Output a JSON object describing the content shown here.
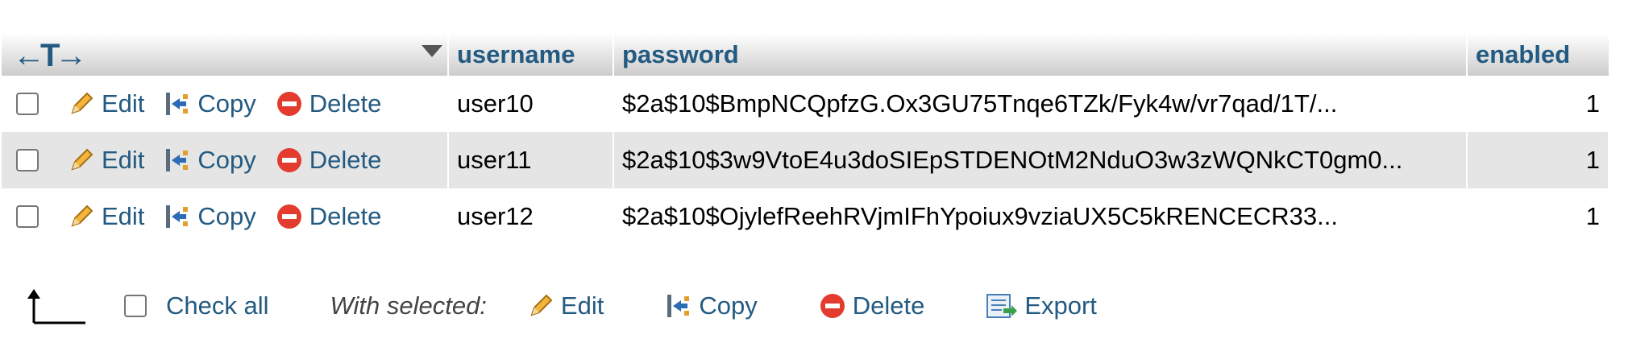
{
  "table": {
    "columns": [
      "username",
      "password",
      "enabled"
    ],
    "rows": [
      {
        "username": "user10",
        "password": "$2a$10$BmpNCQpfzG.Ox3GU75Tnqe6TZk/Fyk4w/vr7qad/1T/...",
        "enabled": "1"
      },
      {
        "username": "user11",
        "password": "$2a$10$3w9VtoE4u3doSIEpSTDENOtM2NduO3w3zWQNkCT0gm0...",
        "enabled": "1"
      },
      {
        "username": "user12",
        "password": "$2a$10$OjylefReehRVjmIFhYpoiux9vziaUX5C5kRENCECR33...",
        "enabled": "1"
      }
    ],
    "row_actions": {
      "edit": "Edit",
      "copy": "Copy",
      "delete": "Delete"
    }
  },
  "header": {
    "arrows": "←T→"
  },
  "bottom": {
    "check_all": "Check all",
    "with_selected": "With selected:",
    "edit": "Edit",
    "copy": "Copy",
    "delete": "Delete",
    "export": "Export"
  },
  "icons": [
    "pencil-icon",
    "copy-icon",
    "delete-icon",
    "export-icon",
    "return-arrow-icon",
    "sort-caret-icon"
  ],
  "colors": {
    "link": "#235a81",
    "row_alt": "#e5e5e5",
    "delete_red": "#e33b2e"
  }
}
